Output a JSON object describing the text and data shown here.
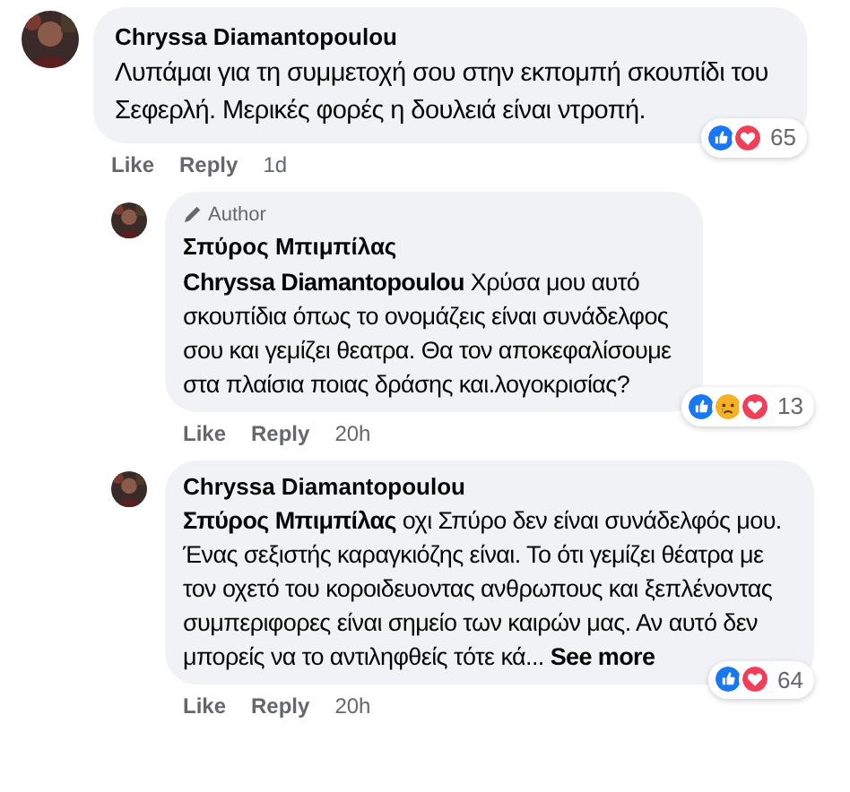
{
  "comment": {
    "author": "Chryssa Diamantopoulou",
    "text": "Λυπάμαι για τη συμμετοχή σου στην εκπομπή σκουπίδι του Σεφερλή. Μερικές φορές η δουλειά είναι ντροπή.",
    "reactions": [
      {
        "kind": "like"
      },
      {
        "kind": "love"
      }
    ],
    "reaction_count": "65",
    "actions": [
      "Like",
      "Reply"
    ],
    "time": "1d",
    "replies": [
      {
        "badge": "Author",
        "author": "Σπύρος Μπιμπίλας",
        "text": "**Chryssa Diamantopoulou** Χρύσα μου αυτό σκουπίδια όπως το ονομάζεις είναι συνάδελφος σου και γεμίζει θεατρα. Θα τον αποκεφαλίσουμε στα πλαίσια ποιας δράσης και.λογοκρισίας?",
        "reactions": [
          {
            "kind": "like"
          },
          {
            "kind": "sad"
          },
          {
            "kind": "love"
          }
        ],
        "reaction_count": "13",
        "actions": [
          "Like",
          "Reply"
        ],
        "time": "20h"
      },
      {
        "author": "Chryssa Diamantopoulou",
        "text": "**Σπύρος Μπιμπίλας** οχι Σπύρο δεν είναι συνάδελφός μου. Ένας σεξιστής καραγκιόζης είναι. Το ότι γεμίζει θέατρα με τον οχετό του κοροιδευοντας ανθρωπους και ξεπλένοντας συμπεριφορες είναι σημείο των καιρών μας. Αν αυτό δεν μπορείς να το αντιληφθείς τότε κά...",
        "see_more": "See more",
        "reactions": [
          {
            "kind": "like"
          },
          {
            "kind": "love"
          }
        ],
        "reaction_count": "64",
        "actions": [
          "Like",
          "Reply"
        ],
        "time": "20h"
      }
    ]
  }
}
